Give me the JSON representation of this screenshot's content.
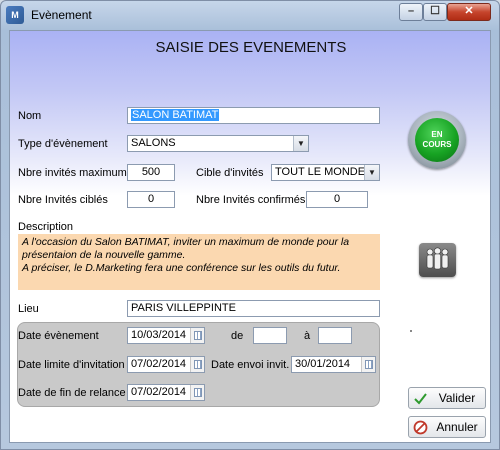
{
  "window": {
    "title": "Evènement",
    "app_icon_text": "M"
  },
  "form_title": "SAISIE DES EVENEMENTS",
  "nom": {
    "label": "Nom",
    "value": "SALON BATIMAT"
  },
  "type": {
    "label": "Type d'évènement",
    "value": "SALONS"
  },
  "invites_max": {
    "label": "Nbre invités maximum",
    "value": "500"
  },
  "cible": {
    "label": "Cible d'invités",
    "value": "TOUT LE MONDE"
  },
  "invites_cibles": {
    "label": "Nbre Invités ciblés",
    "value": "0"
  },
  "invites_confirmes": {
    "label": "Nbre Invités confirmés",
    "value": "0"
  },
  "status": {
    "line1": "EN",
    "line2": "COURS",
    "color": "#17a323"
  },
  "description": {
    "label": "Description",
    "lines": [
      "A l'occasion du Salon BATIMAT, inviter un maximum de monde pour la",
      "présentaion de la nouvelle gamme.",
      "A préciser, le D.Marketing fera une conférence sur les outils du futur."
    ],
    "background": "#fbd8b0"
  },
  "lieu": {
    "label": "Lieu",
    "value": "PARIS VILLEPPINTE"
  },
  "date_evenement": {
    "label": "Date évènement",
    "value": "10/03/2014"
  },
  "heure_de": {
    "label": "de",
    "value": ""
  },
  "heure_a": {
    "label": "à",
    "value": ""
  },
  "date_limite": {
    "label": "Date limite d'invitation",
    "value": "07/02/2014"
  },
  "date_envoi": {
    "label": "Date envoi invit.",
    "value": "30/01/2014"
  },
  "date_fin_relance": {
    "label": "Date de fin de relance",
    "value": "07/02/2014"
  },
  "buttons": {
    "valider": "Valider",
    "annuler": "Annuler"
  },
  "icons": {
    "app": "app-logo-icon",
    "people": "people-group-icon",
    "valider": "checkmark-icon",
    "annuler": "cancel-icon",
    "calendar": "calendar-icon",
    "dropdown": "chevron-down-icon"
  }
}
